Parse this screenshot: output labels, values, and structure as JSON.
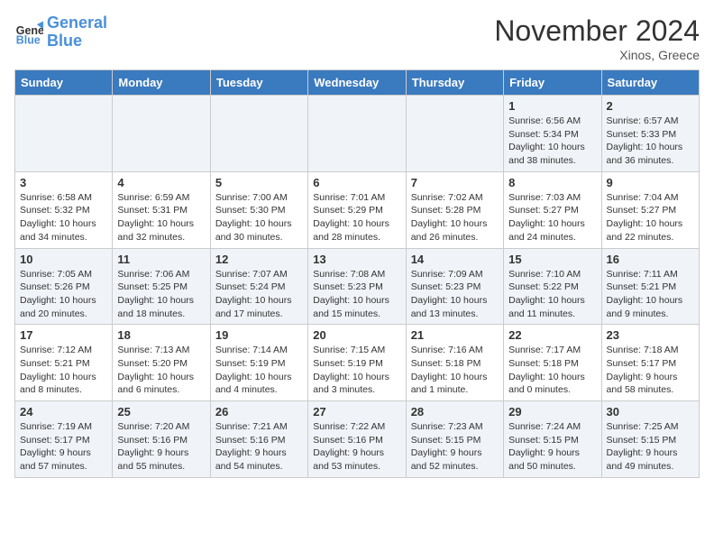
{
  "header": {
    "logo_line1": "General",
    "logo_line2": "Blue",
    "month": "November 2024",
    "location": "Xinos, Greece"
  },
  "weekdays": [
    "Sunday",
    "Monday",
    "Tuesday",
    "Wednesday",
    "Thursday",
    "Friday",
    "Saturday"
  ],
  "weeks": [
    [
      {
        "day": "",
        "info": ""
      },
      {
        "day": "",
        "info": ""
      },
      {
        "day": "",
        "info": ""
      },
      {
        "day": "",
        "info": ""
      },
      {
        "day": "",
        "info": ""
      },
      {
        "day": "1",
        "info": "Sunrise: 6:56 AM\nSunset: 5:34 PM\nDaylight: 10 hours\nand 38 minutes."
      },
      {
        "day": "2",
        "info": "Sunrise: 6:57 AM\nSunset: 5:33 PM\nDaylight: 10 hours\nand 36 minutes."
      }
    ],
    [
      {
        "day": "3",
        "info": "Sunrise: 6:58 AM\nSunset: 5:32 PM\nDaylight: 10 hours\nand 34 minutes."
      },
      {
        "day": "4",
        "info": "Sunrise: 6:59 AM\nSunset: 5:31 PM\nDaylight: 10 hours\nand 32 minutes."
      },
      {
        "day": "5",
        "info": "Sunrise: 7:00 AM\nSunset: 5:30 PM\nDaylight: 10 hours\nand 30 minutes."
      },
      {
        "day": "6",
        "info": "Sunrise: 7:01 AM\nSunset: 5:29 PM\nDaylight: 10 hours\nand 28 minutes."
      },
      {
        "day": "7",
        "info": "Sunrise: 7:02 AM\nSunset: 5:28 PM\nDaylight: 10 hours\nand 26 minutes."
      },
      {
        "day": "8",
        "info": "Sunrise: 7:03 AM\nSunset: 5:27 PM\nDaylight: 10 hours\nand 24 minutes."
      },
      {
        "day": "9",
        "info": "Sunrise: 7:04 AM\nSunset: 5:27 PM\nDaylight: 10 hours\nand 22 minutes."
      }
    ],
    [
      {
        "day": "10",
        "info": "Sunrise: 7:05 AM\nSunset: 5:26 PM\nDaylight: 10 hours\nand 20 minutes."
      },
      {
        "day": "11",
        "info": "Sunrise: 7:06 AM\nSunset: 5:25 PM\nDaylight: 10 hours\nand 18 minutes."
      },
      {
        "day": "12",
        "info": "Sunrise: 7:07 AM\nSunset: 5:24 PM\nDaylight: 10 hours\nand 17 minutes."
      },
      {
        "day": "13",
        "info": "Sunrise: 7:08 AM\nSunset: 5:23 PM\nDaylight: 10 hours\nand 15 minutes."
      },
      {
        "day": "14",
        "info": "Sunrise: 7:09 AM\nSunset: 5:23 PM\nDaylight: 10 hours\nand 13 minutes."
      },
      {
        "day": "15",
        "info": "Sunrise: 7:10 AM\nSunset: 5:22 PM\nDaylight: 10 hours\nand 11 minutes."
      },
      {
        "day": "16",
        "info": "Sunrise: 7:11 AM\nSunset: 5:21 PM\nDaylight: 10 hours\nand 9 minutes."
      }
    ],
    [
      {
        "day": "17",
        "info": "Sunrise: 7:12 AM\nSunset: 5:21 PM\nDaylight: 10 hours\nand 8 minutes."
      },
      {
        "day": "18",
        "info": "Sunrise: 7:13 AM\nSunset: 5:20 PM\nDaylight: 10 hours\nand 6 minutes."
      },
      {
        "day": "19",
        "info": "Sunrise: 7:14 AM\nSunset: 5:19 PM\nDaylight: 10 hours\nand 4 minutes."
      },
      {
        "day": "20",
        "info": "Sunrise: 7:15 AM\nSunset: 5:19 PM\nDaylight: 10 hours\nand 3 minutes."
      },
      {
        "day": "21",
        "info": "Sunrise: 7:16 AM\nSunset: 5:18 PM\nDaylight: 10 hours\nand 1 minute."
      },
      {
        "day": "22",
        "info": "Sunrise: 7:17 AM\nSunset: 5:18 PM\nDaylight: 10 hours\nand 0 minutes."
      },
      {
        "day": "23",
        "info": "Sunrise: 7:18 AM\nSunset: 5:17 PM\nDaylight: 9 hours\nand 58 minutes."
      }
    ],
    [
      {
        "day": "24",
        "info": "Sunrise: 7:19 AM\nSunset: 5:17 PM\nDaylight: 9 hours\nand 57 minutes."
      },
      {
        "day": "25",
        "info": "Sunrise: 7:20 AM\nSunset: 5:16 PM\nDaylight: 9 hours\nand 55 minutes."
      },
      {
        "day": "26",
        "info": "Sunrise: 7:21 AM\nSunset: 5:16 PM\nDaylight: 9 hours\nand 54 minutes."
      },
      {
        "day": "27",
        "info": "Sunrise: 7:22 AM\nSunset: 5:16 PM\nDaylight: 9 hours\nand 53 minutes."
      },
      {
        "day": "28",
        "info": "Sunrise: 7:23 AM\nSunset: 5:15 PM\nDaylight: 9 hours\nand 52 minutes."
      },
      {
        "day": "29",
        "info": "Sunrise: 7:24 AM\nSunset: 5:15 PM\nDaylight: 9 hours\nand 50 minutes."
      },
      {
        "day": "30",
        "info": "Sunrise: 7:25 AM\nSunset: 5:15 PM\nDaylight: 9 hours\nand 49 minutes."
      }
    ]
  ]
}
